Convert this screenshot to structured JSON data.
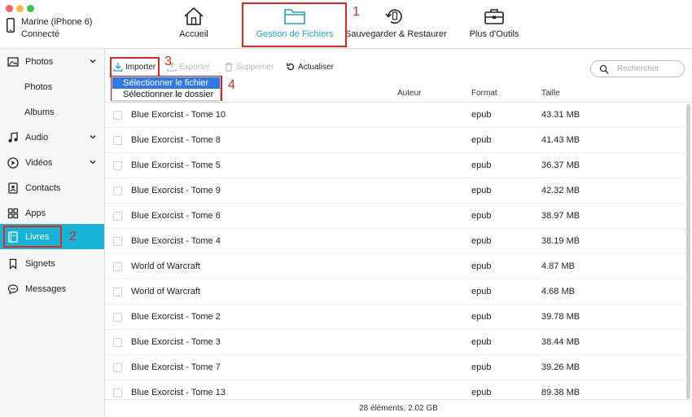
{
  "device": {
    "name": "Marine (iPhone 6)",
    "status": "Connecté"
  },
  "nav": {
    "accueil": "Accueil",
    "gestion": "Gestion de Fichiers",
    "sauvegarder": "Sauvegarder & Restaurer",
    "outils": "Plus d'Outils"
  },
  "sidebar": {
    "photos": "Photos",
    "photos_sub": "Photos",
    "albums": "Albums",
    "audio": "Audio",
    "videos": "Vidéos",
    "contacts": "Contacts",
    "apps": "Apps",
    "livres": "Livres",
    "signets": "Signets",
    "messages": "Messages"
  },
  "toolbar": {
    "importer": "Importer",
    "exporter": "Exporter",
    "supprimer": "Supprimer",
    "actualiser": "Actualiser",
    "search_placeholder": "Rechercher"
  },
  "dropdown": {
    "item1": "Sélectionner le fichier",
    "item2": "Sélectionner le dossier"
  },
  "table": {
    "headers": {
      "auteur": "Auteur",
      "format": "Format",
      "taille": "Taille"
    },
    "rows": [
      {
        "name": "Blue Exorcist - Tome 10",
        "format": "epub",
        "size": "43.31 MB"
      },
      {
        "name": "Blue Exorcist - Tome 8",
        "format": "epub",
        "size": "41.43 MB"
      },
      {
        "name": "Blue Exorcist - Tome 5",
        "format": "epub",
        "size": "36.37 MB"
      },
      {
        "name": "Blue Exorcist - Tome 9",
        "format": "epub",
        "size": "42.32 MB"
      },
      {
        "name": "Blue Exorcist - Tome 6",
        "format": "epub",
        "size": "38.97 MB"
      },
      {
        "name": "Blue Exorcist - Tome 4",
        "format": "epub",
        "size": "38.19 MB"
      },
      {
        "name": "World of Warcraft",
        "format": "epub",
        "size": "4.87 MB"
      },
      {
        "name": "World of Warcraft",
        "format": "epub",
        "size": "4.68 MB"
      },
      {
        "name": "Blue Exorcist - Tome 2",
        "format": "epub",
        "size": "39.78 MB"
      },
      {
        "name": "Blue Exorcist - Tome 3",
        "format": "epub",
        "size": "38.44 MB"
      },
      {
        "name": "Blue Exorcist - Tome 7",
        "format": "epub",
        "size": "39.26 MB"
      },
      {
        "name": "Blue Exorcist - Tome 13",
        "format": "epub",
        "size": "89.38 MB"
      }
    ]
  },
  "footer": {
    "summary": "28 éléments, 2.02 GB"
  },
  "annotations": {
    "a1": "1",
    "a2": "2",
    "a3": "3",
    "a4": "4"
  },
  "colors": {
    "accent": "#17b2d6",
    "annotation_red": "#e1261c",
    "menu_highlight": "#2f78e8"
  }
}
